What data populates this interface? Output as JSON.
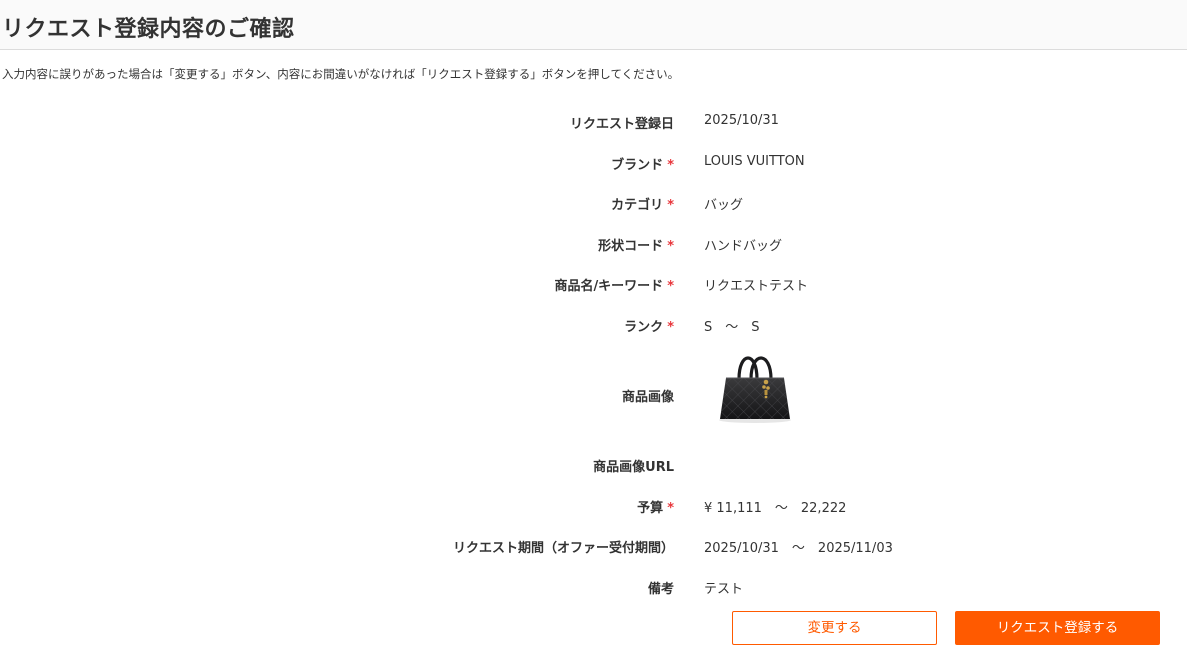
{
  "page": {
    "title": "リクエスト登録内容のご確認",
    "notice": "入力内容に誤りがあった場合は「変更する」ボタン、内容にお間違いがなければ「リクエスト登録する」ボタンを押してください。"
  },
  "fields": [
    {
      "label": "リクエスト登録日",
      "required": false,
      "value": "2025/10/31"
    },
    {
      "label": "ブランド",
      "required": true,
      "value": "LOUIS VUITTON"
    },
    {
      "label": "カテゴリ",
      "required": true,
      "value": "バッグ"
    },
    {
      "label": "形状コード",
      "required": true,
      "value": "ハンドバッグ"
    },
    {
      "label": "商品名/キーワード",
      "required": true,
      "value": "リクエストテスト"
    },
    {
      "label": "ランク",
      "required": true,
      "value": "S　～　S"
    },
    {
      "label": "商品画像",
      "required": false,
      "value": "",
      "image": "black-quilted-handbag"
    },
    {
      "label": "商品画像URL",
      "required": false,
      "value": ""
    },
    {
      "label": "予算",
      "required": true,
      "value": "¥ 11,111　～　22,222"
    },
    {
      "label": "リクエスト期間（オファー受付期間）",
      "required": false,
      "value": "2025/10/31　～　2025/11/03"
    },
    {
      "label": "備考",
      "required": false,
      "value": "テスト"
    }
  ],
  "required_mark": "*",
  "buttons": {
    "change_label": "変更する",
    "submit_label": "リクエスト登録する"
  },
  "colors": {
    "accent": "#ff5a00",
    "required": "#e8363b",
    "text": "#333333"
  }
}
